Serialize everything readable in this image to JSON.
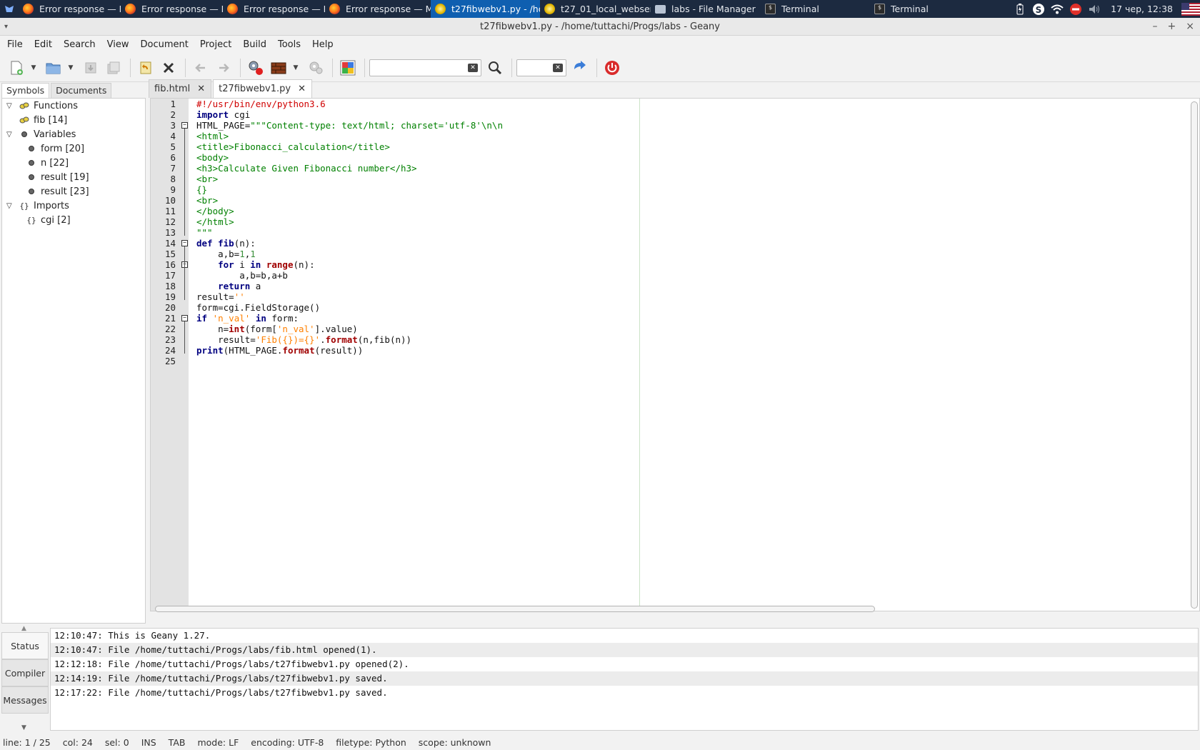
{
  "taskbar": {
    "tasks": [
      {
        "label": "Error response — M...",
        "icon": "firefox-icon"
      },
      {
        "label": "Error response — M...",
        "icon": "firefox-icon"
      },
      {
        "label": "Error response — M...",
        "icon": "firefox-icon"
      },
      {
        "label": "Error response — M...",
        "icon": "firefox-icon"
      },
      {
        "label": "t27fibwebv1.py - /ho...",
        "icon": "geany-icon"
      },
      {
        "label": "t27_01_local_webser...",
        "icon": "geany-icon"
      },
      {
        "label": "labs - File Manager",
        "icon": "folder-icon"
      },
      {
        "label": "Terminal",
        "icon": "terminal-icon"
      },
      {
        "label": "Terminal",
        "icon": "terminal-icon"
      }
    ],
    "clock": "17 чер, 12:38"
  },
  "window": {
    "title": "t27fibwebv1.py - /home/tuttachi/Progs/labs - Geany"
  },
  "menubar": [
    "File",
    "Edit",
    "Search",
    "View",
    "Document",
    "Project",
    "Build",
    "Tools",
    "Help"
  ],
  "toolbar": {
    "search_value": "",
    "goto_value": ""
  },
  "sidebar": {
    "tabs": [
      "Symbols",
      "Documents"
    ],
    "tree": {
      "functions_label": "Functions",
      "functions": [
        "fib [14]"
      ],
      "variables_label": "Variables",
      "variables": [
        "form [20]",
        "n [22]",
        "result [19]",
        "result [23]"
      ],
      "imports_label": "Imports",
      "imports": [
        "cgi [2]"
      ]
    }
  },
  "editor": {
    "tabs": [
      "fib.html",
      "t27fibwebv1.py"
    ],
    "active_tab": "t27fibwebv1.py",
    "line_numbers": [
      "1",
      "2",
      "3",
      "4",
      "5",
      "6",
      "7",
      "8",
      "9",
      "10",
      "11",
      "12",
      "13",
      "14",
      "15",
      "16",
      "17",
      "18",
      "19",
      "20",
      "21",
      "22",
      "23",
      "24",
      "25"
    ],
    "lines": [
      [
        {
          "t": "#!/usr/bin/env/python3.6",
          "c": "shebang"
        }
      ],
      [
        {
          "t": "import",
          "c": "kw"
        },
        {
          "t": " cgi",
          "c": ""
        }
      ],
      [
        {
          "t": "HTML_PAGE=",
          "c": ""
        },
        {
          "t": "\"\"\"Content-type: text/html; charset='utf-8'\\n\\n",
          "c": "str"
        }
      ],
      [
        {
          "t": "<html>",
          "c": "str"
        }
      ],
      [
        {
          "t": "<title>Fibonacci_calculation</title>",
          "c": "str"
        }
      ],
      [
        {
          "t": "<body>",
          "c": "str"
        }
      ],
      [
        {
          "t": "<h3>Calculate Given Fibonacci number</h3>",
          "c": "str"
        }
      ],
      [
        {
          "t": "<br>",
          "c": "str"
        }
      ],
      [
        {
          "t": "{}",
          "c": "str"
        }
      ],
      [
        {
          "t": "<br>",
          "c": "str"
        }
      ],
      [
        {
          "t": "</body>",
          "c": "str"
        }
      ],
      [
        {
          "t": "</html>",
          "c": "str"
        }
      ],
      [
        {
          "t": "\"\"\"",
          "c": "str"
        }
      ],
      [
        {
          "t": "def",
          "c": "kw"
        },
        {
          "t": " ",
          "c": ""
        },
        {
          "t": "fib",
          "c": "kw2"
        },
        {
          "t": "(n):",
          "c": ""
        }
      ],
      [
        {
          "t": "    a,b=",
          "c": ""
        },
        {
          "t": "1",
          "c": "num"
        },
        {
          "t": ",",
          "c": ""
        },
        {
          "t": "1",
          "c": "num"
        }
      ],
      [
        {
          "t": "    ",
          "c": ""
        },
        {
          "t": "for",
          "c": "kw"
        },
        {
          "t": " i ",
          "c": ""
        },
        {
          "t": "in",
          "c": "kw"
        },
        {
          "t": " ",
          "c": ""
        },
        {
          "t": "range",
          "c": "fn"
        },
        {
          "t": "(n):",
          "c": ""
        }
      ],
      [
        {
          "t": "        a,b=b,a+b",
          "c": ""
        }
      ],
      [
        {
          "t": "    ",
          "c": ""
        },
        {
          "t": "return",
          "c": "kw"
        },
        {
          "t": " a",
          "c": ""
        }
      ],
      [
        {
          "t": "result=",
          "c": ""
        },
        {
          "t": "''",
          "c": "sstr"
        }
      ],
      [
        {
          "t": "form=cgi.FieldStorage()",
          "c": ""
        }
      ],
      [
        {
          "t": "if",
          "c": "kw"
        },
        {
          "t": " ",
          "c": ""
        },
        {
          "t": "'n_val'",
          "c": "sstr"
        },
        {
          "t": " ",
          "c": ""
        },
        {
          "t": "in",
          "c": "kw"
        },
        {
          "t": " form:",
          "c": ""
        }
      ],
      [
        {
          "t": "    n=",
          "c": ""
        },
        {
          "t": "int",
          "c": "fn"
        },
        {
          "t": "(form[",
          "c": ""
        },
        {
          "t": "'n_val'",
          "c": "sstr"
        },
        {
          "t": "].value)",
          "c": ""
        }
      ],
      [
        {
          "t": "    result=",
          "c": ""
        },
        {
          "t": "'Fib({})={}'",
          "c": "sstr"
        },
        {
          "t": ".",
          "c": ""
        },
        {
          "t": "format",
          "c": "fn"
        },
        {
          "t": "(n,fib(n))",
          "c": ""
        }
      ],
      [
        {
          "t": "print",
          "c": "kw"
        },
        {
          "t": "(HTML_PAGE.",
          "c": ""
        },
        {
          "t": "format",
          "c": "fn"
        },
        {
          "t": "(result))",
          "c": ""
        }
      ],
      [
        {
          "t": "",
          "c": ""
        }
      ]
    ]
  },
  "messages": {
    "tabs": [
      "Status",
      "Compiler",
      "Messages"
    ],
    "active_tab": "Status",
    "rows": [
      "12:10:47: This is Geany 1.27.",
      "12:10:47: File /home/tuttachi/Progs/labs/fib.html opened(1).",
      "12:12:18: File /home/tuttachi/Progs/labs/t27fibwebv1.py opened(2).",
      "12:14:19: File /home/tuttachi/Progs/labs/t27fibwebv1.py saved.",
      "12:17:22: File /home/tuttachi/Progs/labs/t27fibwebv1.py saved."
    ]
  },
  "statusbar": {
    "line": "line: 1 / 25",
    "col": "col: 24",
    "sel": "sel: 0",
    "ins": "INS",
    "tab": "TAB",
    "mode": "mode: LF",
    "encoding": "encoding: UTF-8",
    "filetype": "filetype: Python",
    "scope": "scope: unknown"
  }
}
